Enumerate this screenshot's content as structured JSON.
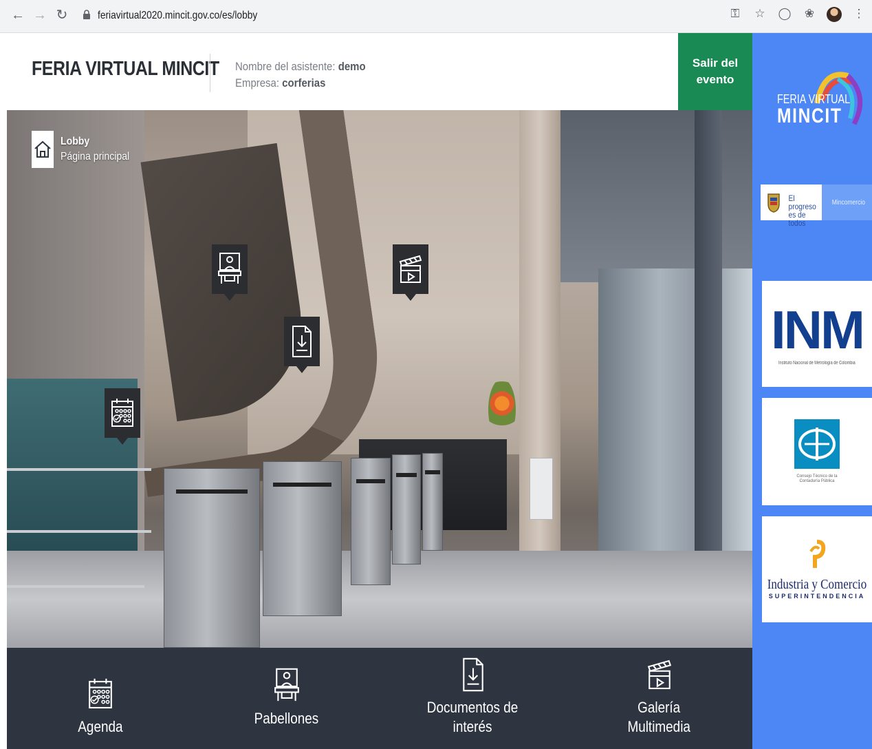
{
  "browser": {
    "url": "feriavirtual2020.mincit.gov.co/es/lobby"
  },
  "header": {
    "brand": "FERIA VIRTUAL MINCIT",
    "attendee_label": "Nombre del asistente:",
    "attendee_value": "demo",
    "company_label": "Empresa:",
    "company_value": "corferias",
    "exit_line1": "Salir del",
    "exit_line2": "evento"
  },
  "lobby": {
    "title": "Lobby",
    "subtitle": "Página principal"
  },
  "hotspots": [
    {
      "name": "pabellones",
      "icon": "exhibitor-booth-icon"
    },
    {
      "name": "galeria",
      "icon": "clapperboard-icon"
    },
    {
      "name": "documentos",
      "icon": "document-download-icon"
    },
    {
      "name": "agenda",
      "icon": "calendar-icon"
    }
  ],
  "bottom_nav": [
    {
      "label": "Agenda",
      "icon": "calendar-icon"
    },
    {
      "label": "Pabellones",
      "icon": "exhibitor-booth-icon"
    },
    {
      "label": "Documentos de\ninterés",
      "icon": "document-download-icon"
    },
    {
      "label": "Galería\nMultimedia",
      "icon": "clapperboard-icon"
    }
  ],
  "sidebar": {
    "logo_line1": "FERIA VIRTUAL",
    "logo_line2": "MINCIT",
    "gov_motto": "El progreso es de todos",
    "gov_ministry": "Mincomercio",
    "sponsors": [
      {
        "name": "INM",
        "text": "INM",
        "subtitle": "Instituto Nacional de Metrología de Colombia"
      },
      {
        "name": "CTCP",
        "subtitle": "Consejo Técnico de la\nContaduría Pública"
      },
      {
        "name": "SIC",
        "text": "Industria y Comercio",
        "subtitle": "SUPERINTENDENCIA"
      }
    ]
  },
  "colors": {
    "exit_button": "#1a8a55",
    "sidebar": "#4d86f5",
    "bottom_nav": "#2e3540"
  }
}
